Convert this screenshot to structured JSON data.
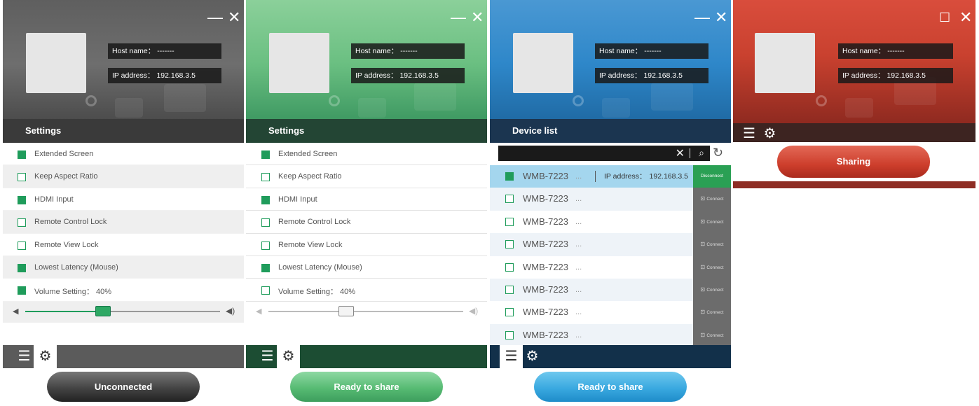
{
  "window_controls": {
    "minimize": "—",
    "close": "✕",
    "maximize": "☐"
  },
  "host": {
    "host_label": "Host name：",
    "host_value": "-------",
    "ip_label": "IP address：",
    "ip_value": "192.168.3.5"
  },
  "panel1": {
    "section_title": "Settings",
    "rows": [
      {
        "label": "Extended Screen",
        "checked": true
      },
      {
        "label": "Keep Aspect Ratio",
        "checked": false
      },
      {
        "label": "HDMI Input",
        "checked": true
      },
      {
        "label": "Remote Control Lock",
        "checked": false
      },
      {
        "label": "Remote View Lock",
        "checked": false
      },
      {
        "label": "Lowest Latency (Mouse)",
        "checked": true
      },
      {
        "label": "Volume Setting：  40%",
        "checked": true
      }
    ],
    "volume_percent": 40,
    "status_button": "Unconnected"
  },
  "panel2": {
    "section_title": "Settings",
    "rows": [
      {
        "label": "Extended Screen",
        "checked": true
      },
      {
        "label": "Keep Aspect Ratio",
        "checked": false
      },
      {
        "label": "HDMI Input",
        "checked": true
      },
      {
        "label": "Remote Control Lock",
        "checked": false
      },
      {
        "label": "Remote View Lock",
        "checked": false
      },
      {
        "label": "Lowest Latency (Mouse)",
        "checked": true
      },
      {
        "label": "Volume Setting：  40%",
        "checked": false
      }
    ],
    "volume_percent": 40,
    "status_button": "Ready to share"
  },
  "panel3": {
    "section_title": "Device list",
    "devices": [
      {
        "name": "WMB-7223",
        "more": "...",
        "ip_label": "IP address：",
        "ip": "192.168.3.5",
        "action": "Disconnect",
        "selected": true
      },
      {
        "name": "WMB-7223",
        "more": "...",
        "action": "Connect",
        "selected": false
      },
      {
        "name": "WMB-7223",
        "more": "...",
        "action": "Connect",
        "selected": false
      },
      {
        "name": "WMB-7223",
        "more": "...",
        "action": "Connect",
        "selected": false
      },
      {
        "name": "WMB-7223",
        "more": "...",
        "action": "Connect",
        "selected": false
      },
      {
        "name": "WMB-7223",
        "more": "...",
        "action": "Connect",
        "selected": false
      },
      {
        "name": "WMB-7223",
        "more": "...",
        "action": "Connect",
        "selected": false
      },
      {
        "name": "WMB-7223",
        "more": "...",
        "action": "Connect",
        "selected": false
      }
    ],
    "status_button": "Ready to share"
  },
  "panel4": {
    "status_button": "Sharing"
  },
  "icons": {
    "list": "☰",
    "gear": "⚙",
    "speaker_low": "◀",
    "speaker_high": "◀))",
    "search": "🔍",
    "clear": "✕",
    "refresh": "↻",
    "lock": "🔒"
  },
  "colors": {
    "accent_green": "#1f9c5b",
    "panel1": "#5f5f5f",
    "panel2": "#6abf81",
    "panel3": "#2e87c9",
    "panel4": "#c9412f"
  }
}
